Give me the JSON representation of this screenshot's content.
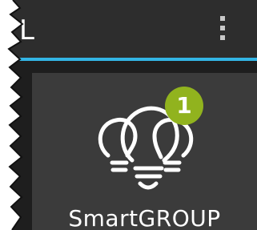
{
  "appbar": {
    "title_fragment": "L",
    "overflow_icon": "vertical-ellipsis"
  },
  "tile": {
    "icon": "smart-bulbs-icon",
    "badge_count": "1",
    "label": "SmartGROUP"
  },
  "colors": {
    "appbar_bg": "#2d2d2d",
    "accent": "#33b5e5",
    "content_bg": "#1e1e1e",
    "tile_bg": "#3b3b3b",
    "badge": "#91b31e",
    "text": "#ffffff"
  }
}
